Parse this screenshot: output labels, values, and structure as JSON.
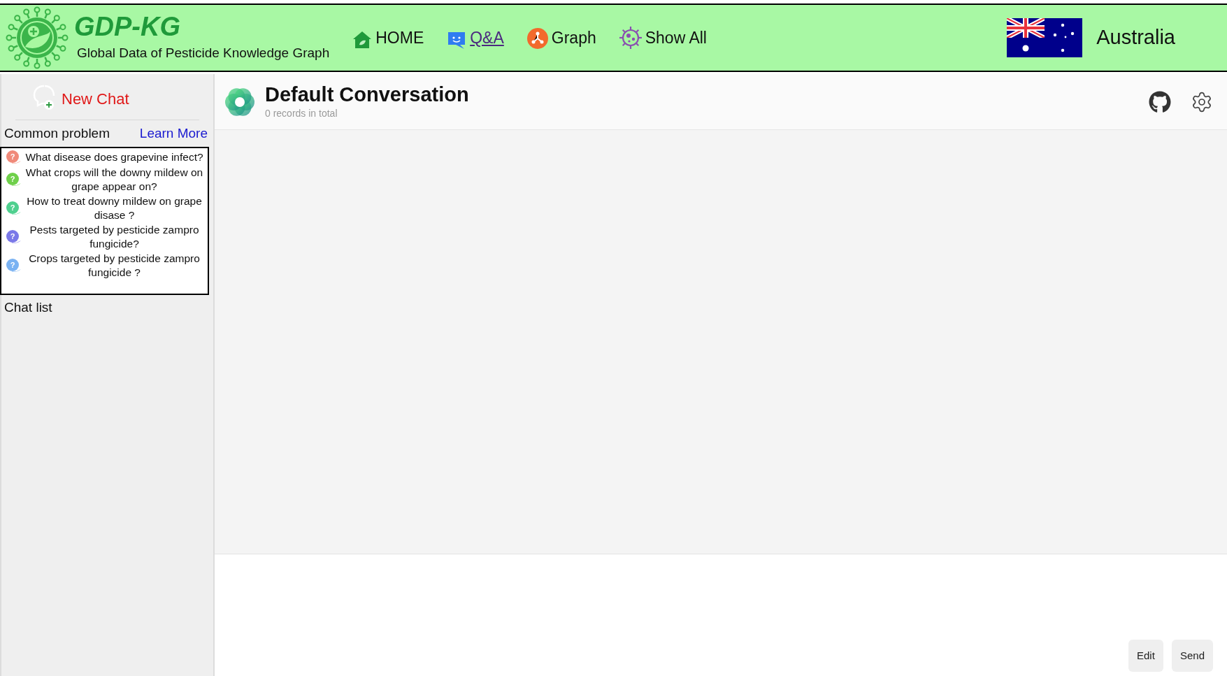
{
  "header": {
    "logo_text": "GDP-KG",
    "subtitle": "Global Data of Pesticide Knowledge Graph",
    "nav": [
      {
        "label": "HOME",
        "kind": "home",
        "selected": false
      },
      {
        "label": "Q&A",
        "kind": "chat",
        "selected": true
      },
      {
        "label": "Graph",
        "kind": "graph",
        "selected": false
      },
      {
        "label": "Show All",
        "kind": "virus",
        "selected": false
      }
    ],
    "region": "Australia"
  },
  "sidebar": {
    "new_chat": "New Chat",
    "common_problem": "Common problem",
    "learn_more": "Learn More",
    "questions": [
      {
        "icon": "?",
        "text": "What disease does grapevine infect?",
        "color": "#f08a7a"
      },
      {
        "icon": "?",
        "text": "What crops will the downy mildew on grape appear on?",
        "color": "#6fd04a"
      },
      {
        "icon": "?",
        "text": "How to treat downy mildew on grape disase ?",
        "color": "#4fd08f"
      },
      {
        "icon": "?",
        "text": "Pests targeted by pesticide zampro fungicide?",
        "color": "#7a78e8"
      },
      {
        "icon": "?",
        "text": "Crops targeted by pesticide zampro fungicide ?",
        "color": "#7ab2f2"
      }
    ],
    "chat_list": "Chat list"
  },
  "conversation": {
    "title": "Default Conversation",
    "subtitle": "0 records in total"
  },
  "composer": {
    "buttons": [
      "Edit",
      "Send"
    ]
  }
}
